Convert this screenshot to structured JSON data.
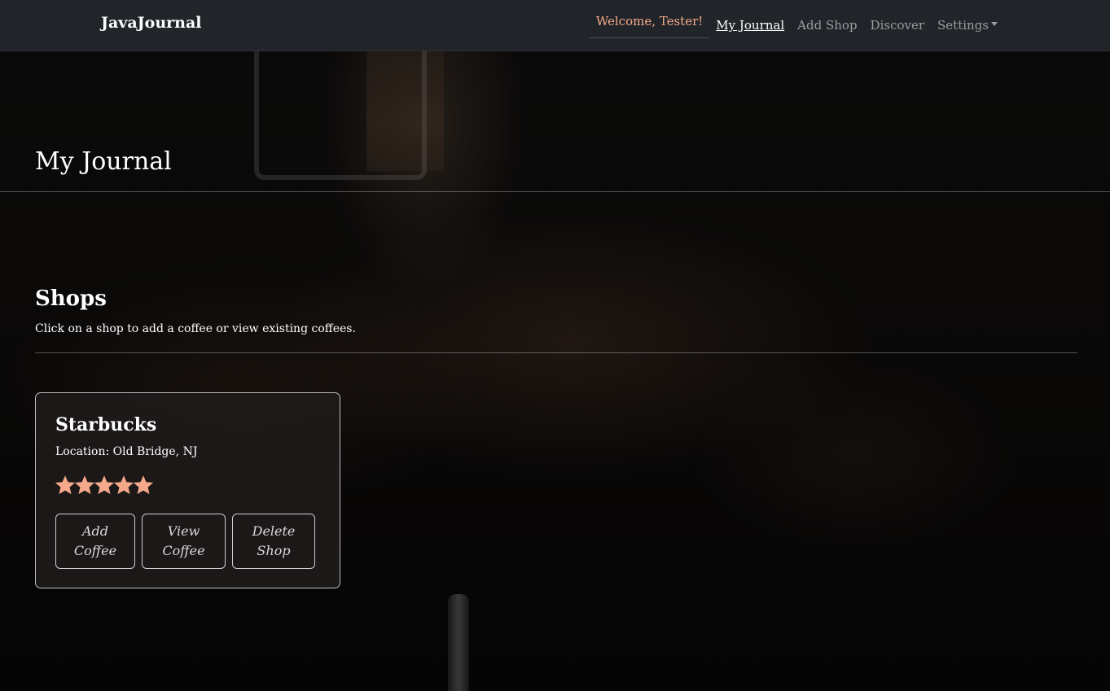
{
  "navbar": {
    "brand": "JavaJournal",
    "welcome": "Welcome, Tester!",
    "links": {
      "my_journal": "My Journal",
      "add_shop": "Add Shop",
      "discover": "Discover",
      "settings": "Settings"
    }
  },
  "page": {
    "title": "My Journal"
  },
  "shops_section": {
    "title": "Shops",
    "subtitle": "Click on a shop to add a coffee or view existing coffees."
  },
  "shop_card": {
    "name": "Starbucks",
    "location": "Location: Old Bridge, NJ",
    "rating": 5,
    "rating_max": 5,
    "buttons": {
      "add_coffee": "Add Coffee",
      "view_coffee": "View Coffee",
      "delete_shop": "Delete Shop"
    }
  },
  "colors": {
    "accent": "#f4a98a",
    "navbar_bg": "#212529",
    "star": "#f4a98a"
  }
}
